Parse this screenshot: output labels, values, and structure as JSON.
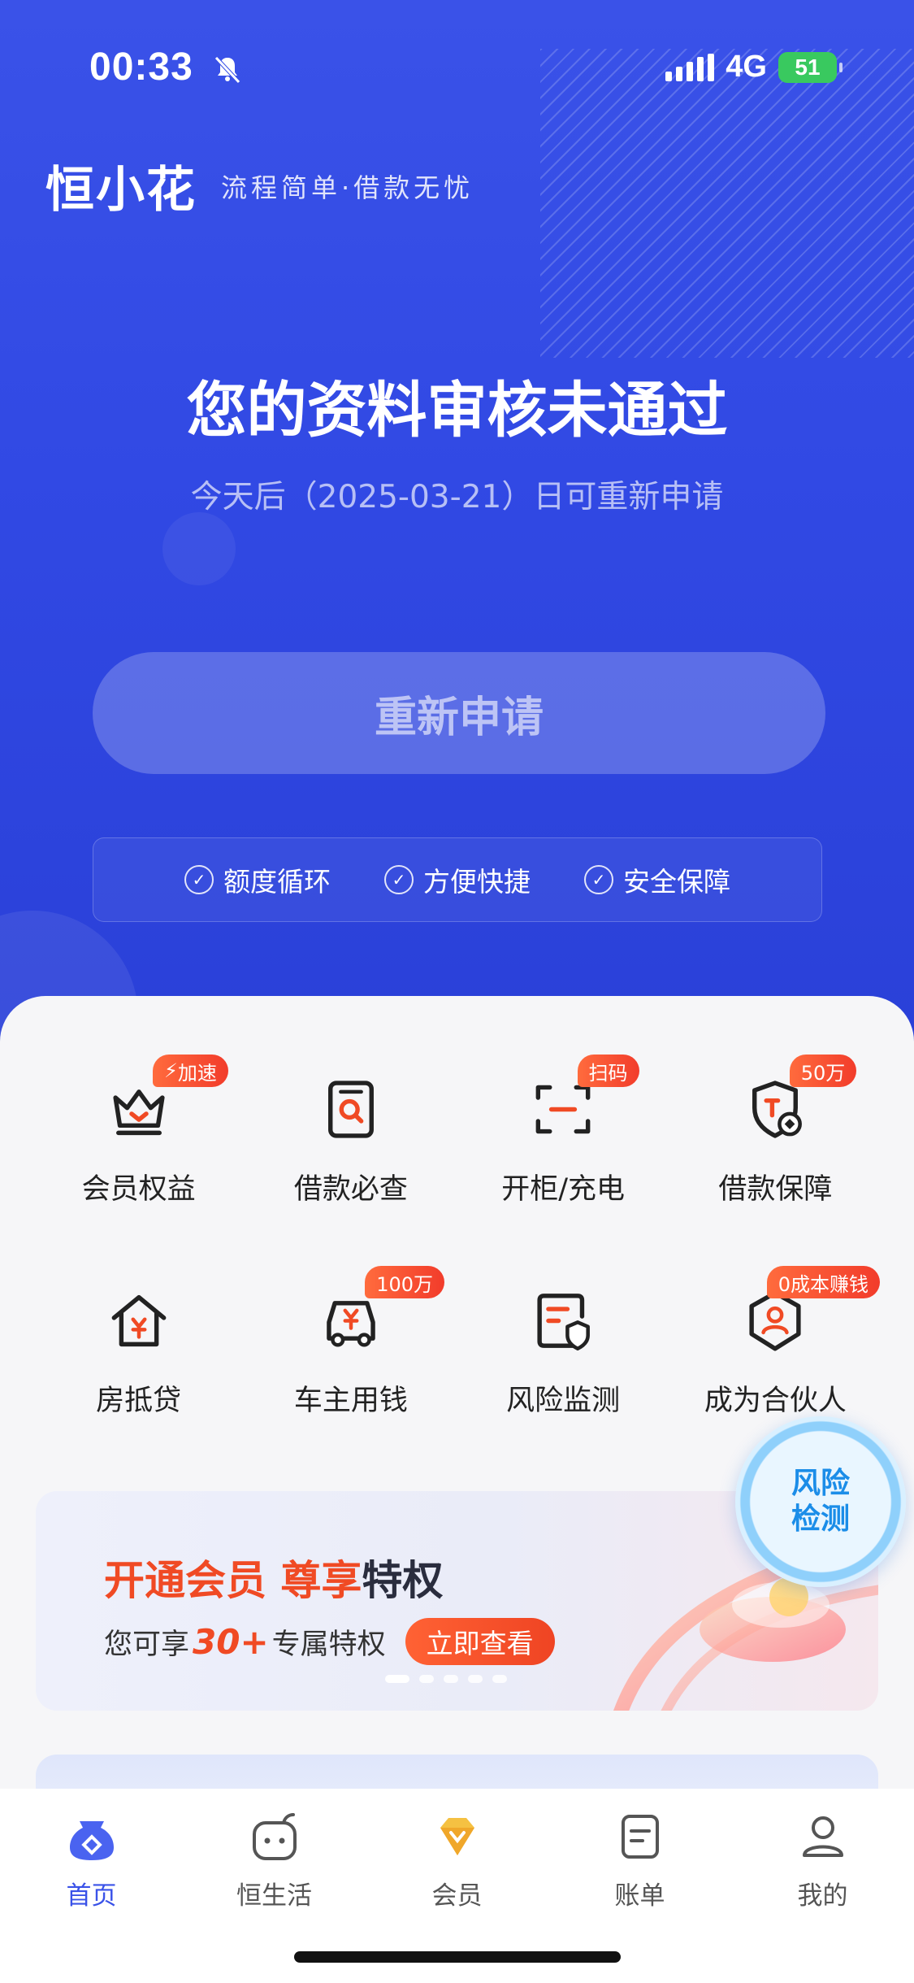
{
  "status_bar": {
    "time": "00:33",
    "network": "4G",
    "battery": "51"
  },
  "brand": {
    "logo": "恒小花",
    "slogan": "流程简单·借款无忧"
  },
  "review": {
    "title": "您的资料审核未通过",
    "subtitle": "今天后（2025-03-21）日可重新申请",
    "reapply_label": "重新申请"
  },
  "features": [
    "额度循环",
    "方便快捷",
    "安全保障"
  ],
  "services": [
    {
      "label": "会员权益",
      "badge": "加速",
      "icon": "crown-icon"
    },
    {
      "label": "借款必查",
      "badge": "",
      "icon": "search-document-icon"
    },
    {
      "label": "开柜/充电",
      "badge": "扫码",
      "icon": "scan-icon"
    },
    {
      "label": "借款保障",
      "badge": "50万",
      "icon": "shield-coin-icon"
    },
    {
      "label": "房抵贷",
      "badge": "",
      "icon": "house-yuan-icon"
    },
    {
      "label": "车主用钱",
      "badge": "100万",
      "icon": "car-yuan-icon"
    },
    {
      "label": "风险监测",
      "badge": "",
      "icon": "document-shield-icon"
    },
    {
      "label": "成为合伙人",
      "badge": "0成本赚钱",
      "icon": "partner-icon"
    }
  ],
  "banner": {
    "title_orange": "开通会员 尊享",
    "title_dark": "特权",
    "sub_prefix": "您可享",
    "sub_num": "30+",
    "sub_suffix": "专属特权",
    "cta": "立即查看"
  },
  "risk_float": {
    "line1": "风险",
    "line2": "检测"
  },
  "tabs": [
    {
      "label": "首页",
      "icon": "home-icon",
      "active": true
    },
    {
      "label": "恒生活",
      "icon": "life-icon",
      "active": false
    },
    {
      "label": "会员",
      "icon": "diamond-icon",
      "active": false
    },
    {
      "label": "账单",
      "icon": "bill-icon",
      "active": false
    },
    {
      "label": "我的",
      "icon": "profile-icon",
      "active": false
    }
  ],
  "colors": {
    "brand_blue": "#3a52e8",
    "accent_orange": "#f04a24",
    "risk_blue": "#1b8de8"
  }
}
